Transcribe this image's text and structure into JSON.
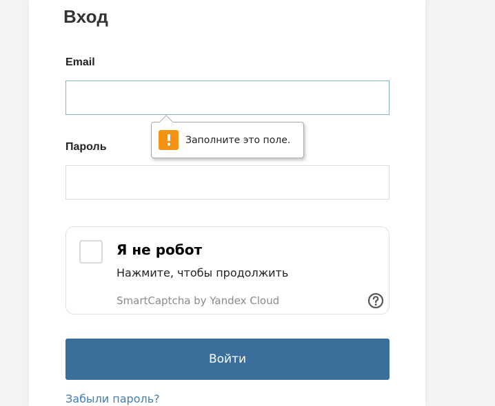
{
  "form": {
    "title": "Вход",
    "email": {
      "label": "Email",
      "value": "",
      "placeholder": ""
    },
    "password": {
      "label": "Пароль",
      "value": "",
      "placeholder": ""
    },
    "submit_label": "Войти",
    "forgot_label": "Забыли пароль?"
  },
  "validation_tooltip": {
    "icon": "warning-icon",
    "text": "Заполните это поле.",
    "accent_color": "#f39214"
  },
  "captcha": {
    "title": "Я не робот",
    "subtitle": "Нажмите, чтобы продолжить",
    "brand": "SmartCaptcha by Yandex Cloud",
    "checked": false,
    "help_icon": "help-circle-icon"
  },
  "colors": {
    "primary_button": "#3a6f9b",
    "link": "#3f7db5",
    "focus_border": "#84b3c6"
  }
}
